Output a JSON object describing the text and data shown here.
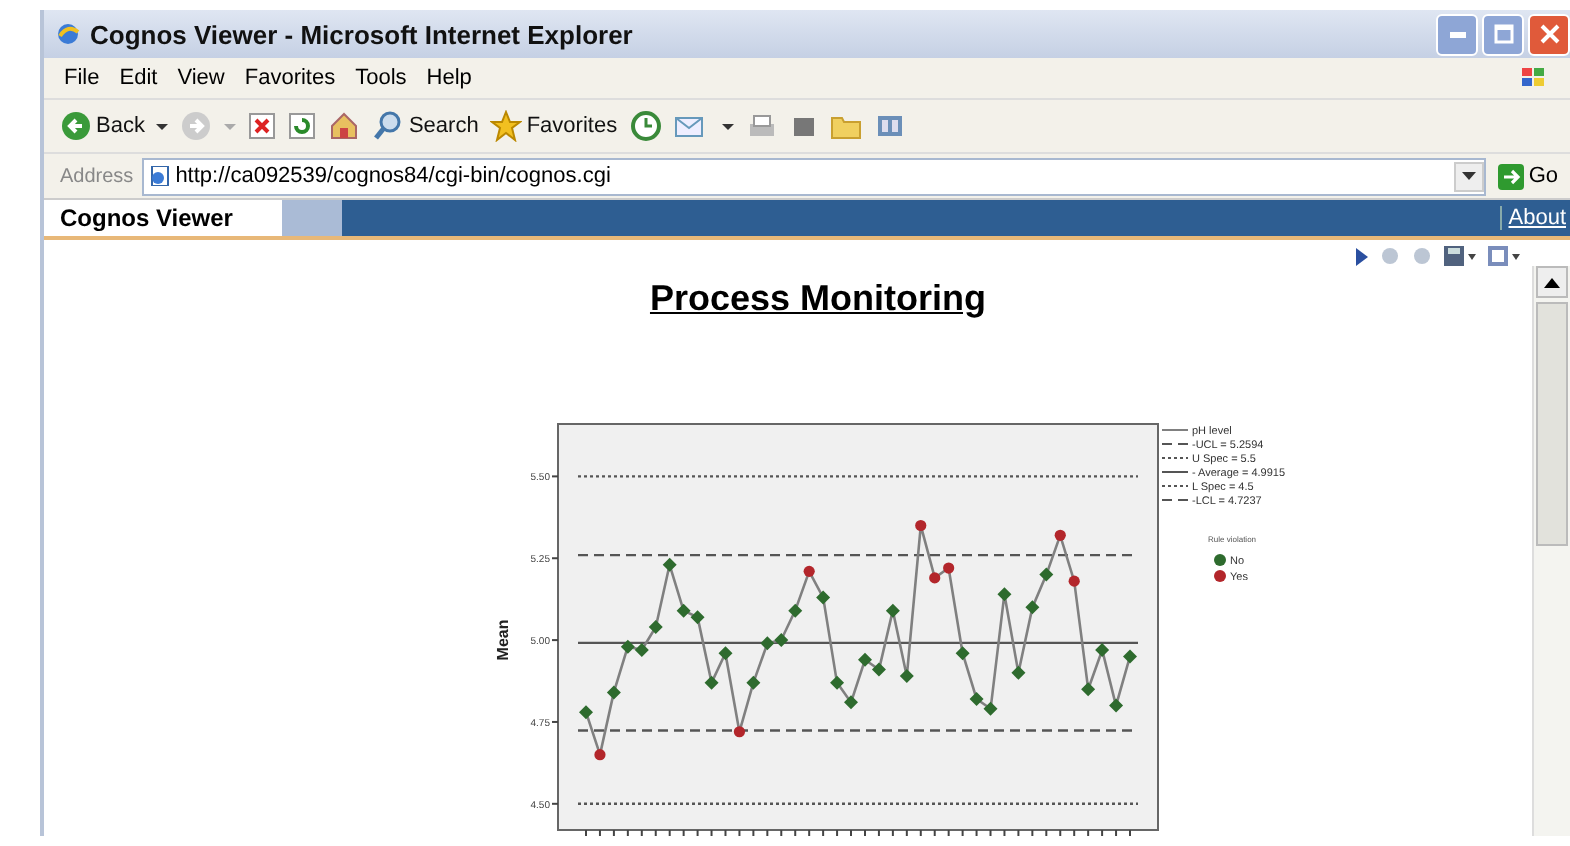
{
  "window": {
    "title": "Cognos Viewer - Microsoft Internet Explorer"
  },
  "menu": [
    "File",
    "Edit",
    "View",
    "Favorites",
    "Tools",
    "Help"
  ],
  "toolbar": [
    {
      "label": "Back"
    },
    {
      "label": "Search"
    },
    {
      "label": "Favorites"
    }
  ],
  "address_bar": {
    "label": "Address",
    "value": "http://ca092539/cognos84/cgi-bin/cognos.cgi",
    "go": "Go"
  },
  "viewer": {
    "tab": "Cognos Viewer",
    "link": "About"
  },
  "report": {
    "title": "Process Monitoring",
    "chart_data": {
      "type": "line",
      "legend": true,
      "ylabel": "Mean",
      "ylim": [
        4.42,
        5.66
      ],
      "yticks": [
        {
          "value": 4.5,
          "label": "4.50"
        },
        {
          "value": 4.75,
          "label": "4.75"
        },
        {
          "value": 5.0,
          "label": "5.00"
        },
        {
          "value": 5.25,
          "label": "5.25"
        },
        {
          "value": 5.5,
          "label": "5.50"
        }
      ],
      "series": [
        {
          "name": "pH level",
          "color": "#808080",
          "marker": true,
          "values": [
            4.78,
            4.65,
            4.84,
            4.98,
            4.97,
            5.04,
            5.23,
            5.09,
            5.07,
            4.87,
            4.96,
            4.72,
            4.87,
            4.99,
            5.0,
            5.09,
            5.21,
            5.13,
            4.87,
            4.81,
            4.94,
            4.91,
            5.09,
            4.89,
            5.35,
            5.19,
            5.22,
            4.96,
            4.82,
            4.79,
            5.14,
            4.9,
            5.1,
            5.2,
            5.32,
            5.18,
            4.85,
            4.97,
            4.8,
            4.95
          ]
        }
      ],
      "ref_lines": [
        {
          "axis": "y",
          "value": 5.2594,
          "label": "-UCL = 5.2594"
        },
        {
          "axis": "y",
          "value": 5.5,
          "label": "U Spec = 5.5"
        },
        {
          "axis": "y",
          "value": 4.9915,
          "label": "- Average = 4.9915"
        },
        {
          "axis": "y",
          "value": 4.5,
          "label": "L Spec = 4.5"
        },
        {
          "axis": "y",
          "value": 4.7237,
          "label": "-LCL = 4.7237"
        }
      ]
    },
    "rule_violation": [
      {
        "violation": false
      },
      {
        "violation": true
      },
      {
        "violation": false
      },
      {
        "violation": false
      },
      {
        "violation": false
      },
      {
        "violation": false
      },
      {
        "violation": false
      },
      {
        "violation": false
      },
      {
        "violation": false
      },
      {
        "violation": false
      },
      {
        "violation": false
      },
      {
        "violation": true
      },
      {
        "violation": false
      },
      {
        "violation": false
      },
      {
        "violation": false
      },
      {
        "violation": false
      },
      {
        "violation": true
      },
      {
        "violation": false
      },
      {
        "violation": false
      },
      {
        "violation": false
      },
      {
        "violation": false
      },
      {
        "violation": false
      },
      {
        "violation": false
      },
      {
        "violation": false
      },
      {
        "violation": true
      },
      {
        "violation": true
      },
      {
        "violation": true
      },
      {
        "violation": false
      },
      {
        "violation": false
      },
      {
        "violation": false
      },
      {
        "violation": false
      },
      {
        "violation": false
      },
      {
        "violation": false
      },
      {
        "violation": false
      },
      {
        "violation": true
      },
      {
        "violation": true
      },
      {
        "violation": false
      },
      {
        "violation": false
      },
      {
        "violation": false
      },
      {
        "violation": false
      }
    ],
    "legend": {
      "title": "Rule violation",
      "items": [
        {
          "label": "No",
          "color": "#2e6b2e"
        },
        {
          "label": "Yes",
          "color": "#b3262b"
        }
      ]
    }
  }
}
